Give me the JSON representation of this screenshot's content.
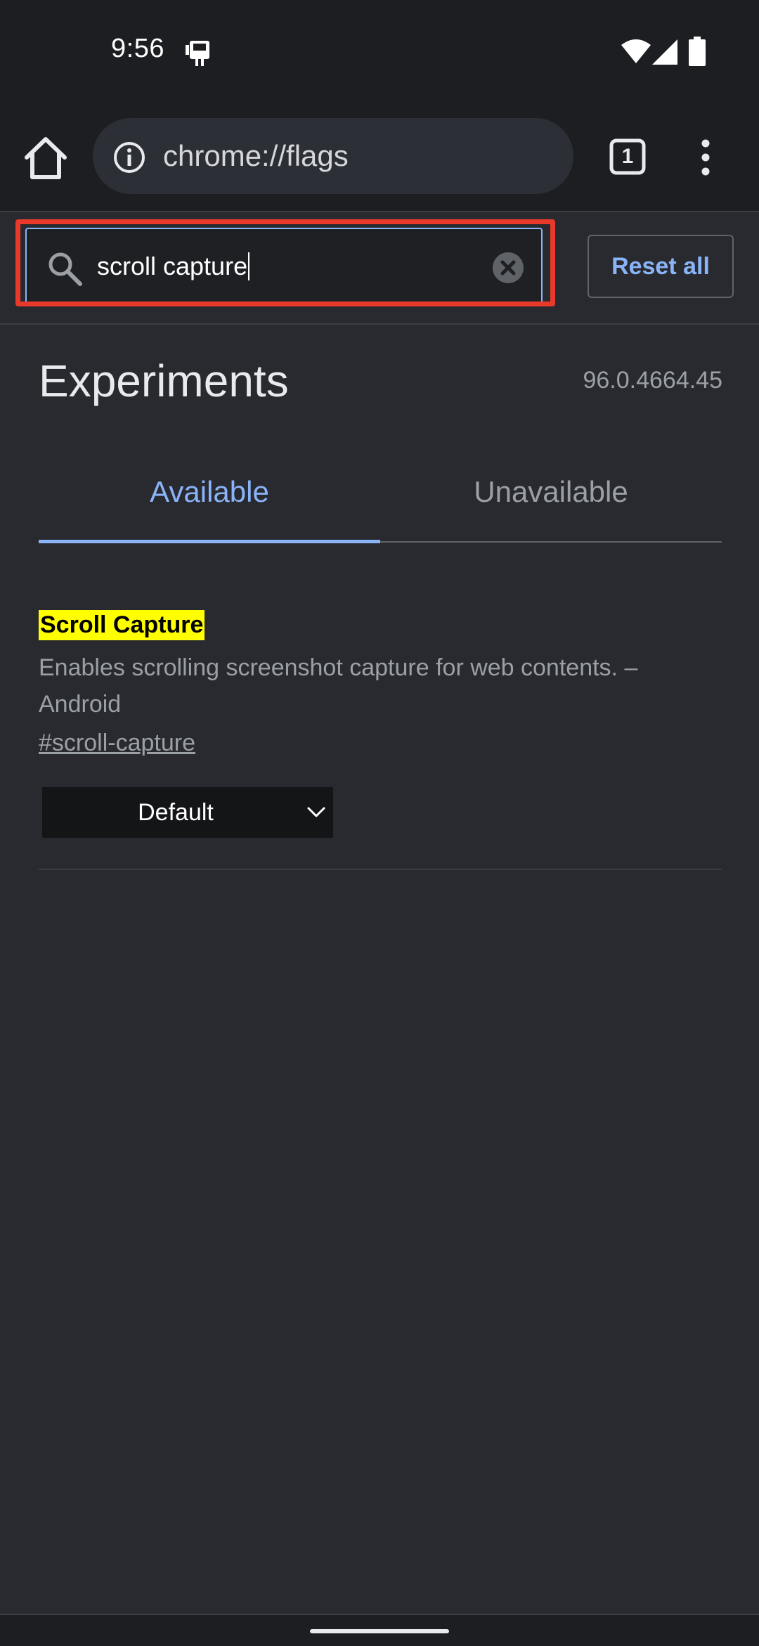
{
  "status_bar": {
    "time": "9:56",
    "icons": [
      "notification-icon",
      "wifi-icon",
      "signal-icon",
      "battery-icon"
    ]
  },
  "toolbar": {
    "url": "chrome://flags",
    "tab_count": "1",
    "icons": [
      "home-icon",
      "info-icon",
      "tab-switcher-icon",
      "more-vert-icon"
    ]
  },
  "search": {
    "value": "scroll capture",
    "reset_label": "Reset all",
    "icons": [
      "search-icon",
      "clear-icon"
    ]
  },
  "page": {
    "title": "Experiments",
    "version": "96.0.4664.45",
    "tabs": [
      {
        "label": "Available",
        "selected": true
      },
      {
        "label": "Unavailable",
        "selected": false
      }
    ]
  },
  "flags": [
    {
      "title": "Scroll Capture",
      "description": "Enables scrolling screenshot capture for web contents. – Android",
      "link": "#scroll-capture",
      "selected_option": "Default"
    }
  ],
  "colors": {
    "accent": "#8ab4f8",
    "highlight": "#ffff00",
    "annotation_box": "#e8392b",
    "background": "#292a2f",
    "toolbar": "#1d1e22"
  }
}
